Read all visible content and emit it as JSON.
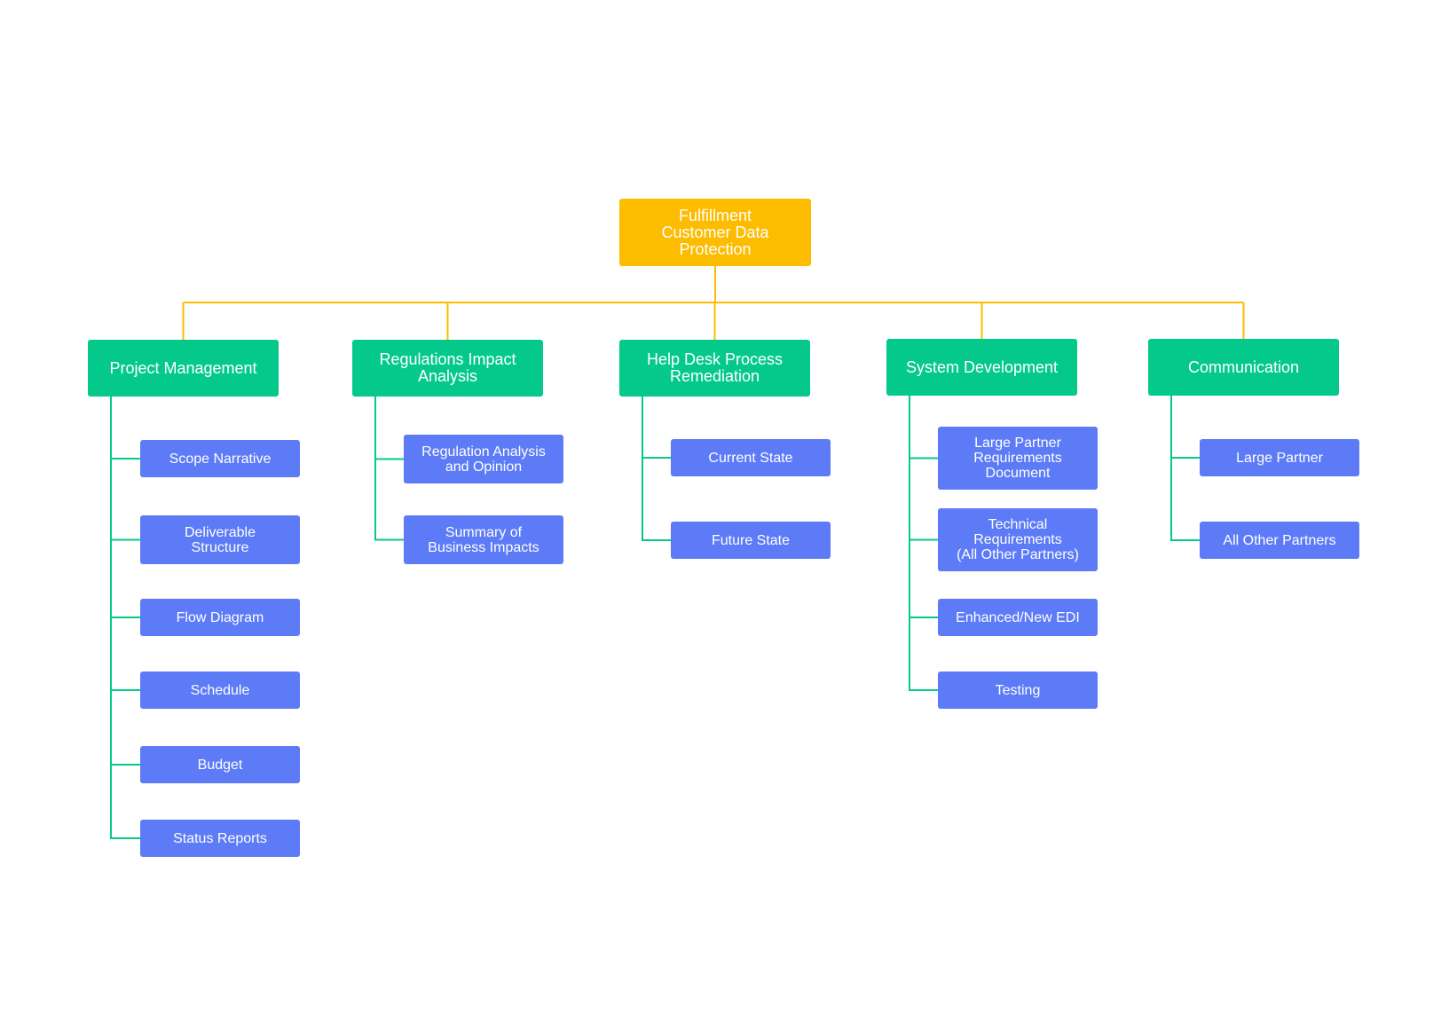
{
  "colors": {
    "root": "#fdbc00",
    "category": "#05c98a",
    "leaf": "#5d7bf6",
    "root_connector": "#fdbc00",
    "category_connector": "#05c98a"
  },
  "root": {
    "label": "Fulfillment\nCustomer Data\nProtection"
  },
  "categories": [
    {
      "label": "Project Management",
      "children": [
        "Scope Narrative",
        "Deliverable\nStructure",
        "Flow Diagram",
        "Schedule",
        "Budget",
        "Status Reports"
      ]
    },
    {
      "label": "Regulations Impact\nAnalysis",
      "children": [
        "Regulation Analysis\nand Opinion",
        "Summary of\nBusiness Impacts"
      ]
    },
    {
      "label": "Help Desk Process\nRemediation",
      "children": [
        "Current State",
        "Future State"
      ]
    },
    {
      "label": "System Development",
      "children": [
        "Large Partner\nRequirements\nDocument",
        "Technical\nRequirements\n(All Other Partners)",
        "Enhanced/New EDI",
        "Testing"
      ]
    },
    {
      "label": "Communication",
      "children": [
        "Large Partner",
        "All Other Partners"
      ]
    }
  ]
}
